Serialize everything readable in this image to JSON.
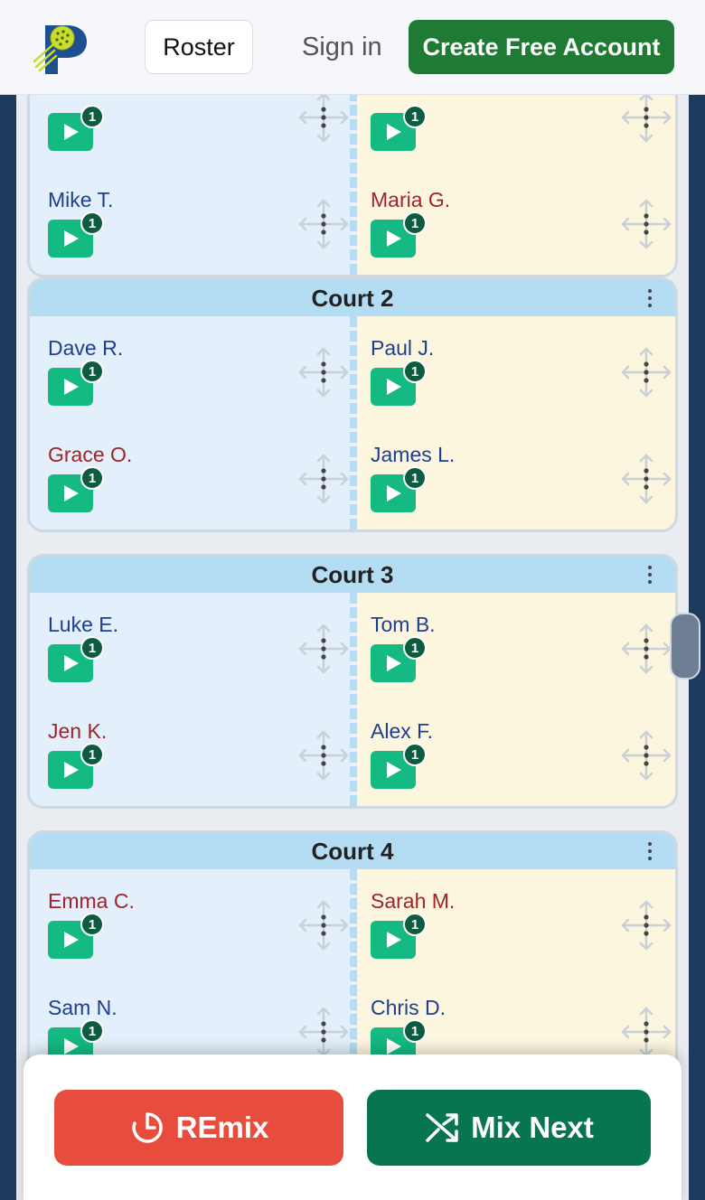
{
  "header": {
    "roster_label": "Roster",
    "signin_label": "Sign in",
    "create_label": "Create Free Account"
  },
  "courts": [
    {
      "title": "",
      "left": [
        {
          "name": "",
          "color": "blue",
          "count": "1"
        },
        {
          "name": "Mike T.",
          "color": "blue",
          "count": "1"
        }
      ],
      "right": [
        {
          "name": "",
          "color": "red",
          "count": "1"
        },
        {
          "name": "Maria G.",
          "color": "red",
          "count": "1"
        }
      ]
    },
    {
      "title": "Court 2",
      "left": [
        {
          "name": "Dave R.",
          "color": "blue",
          "count": "1"
        },
        {
          "name": "Grace O.",
          "color": "red",
          "count": "1"
        }
      ],
      "right": [
        {
          "name": "Paul J.",
          "color": "blue",
          "count": "1"
        },
        {
          "name": "James L.",
          "color": "blue",
          "count": "1"
        }
      ]
    },
    {
      "title": "Court 3",
      "left": [
        {
          "name": "Luke E.",
          "color": "blue",
          "count": "1"
        },
        {
          "name": "Jen K.",
          "color": "red",
          "count": "1"
        }
      ],
      "right": [
        {
          "name": "Tom B.",
          "color": "blue",
          "count": "1"
        },
        {
          "name": "Alex F.",
          "color": "blue",
          "count": "1"
        }
      ]
    },
    {
      "title": "Court 4",
      "left": [
        {
          "name": "Emma C.",
          "color": "red",
          "count": "1"
        },
        {
          "name": "Sam N.",
          "color": "blue",
          "count": "1"
        }
      ],
      "right": [
        {
          "name": "Sarah M.",
          "color": "red",
          "count": "1"
        },
        {
          "name": "Chris D.",
          "color": "blue",
          "count": "1"
        }
      ]
    }
  ],
  "actions": {
    "remix_label": "REmix",
    "mix_next_label": "Mix Next"
  },
  "colors": {
    "accent_green": "#1f7a34",
    "remix_red": "#e84c3d",
    "mix_green": "#067550",
    "play_green": "#15b982"
  }
}
